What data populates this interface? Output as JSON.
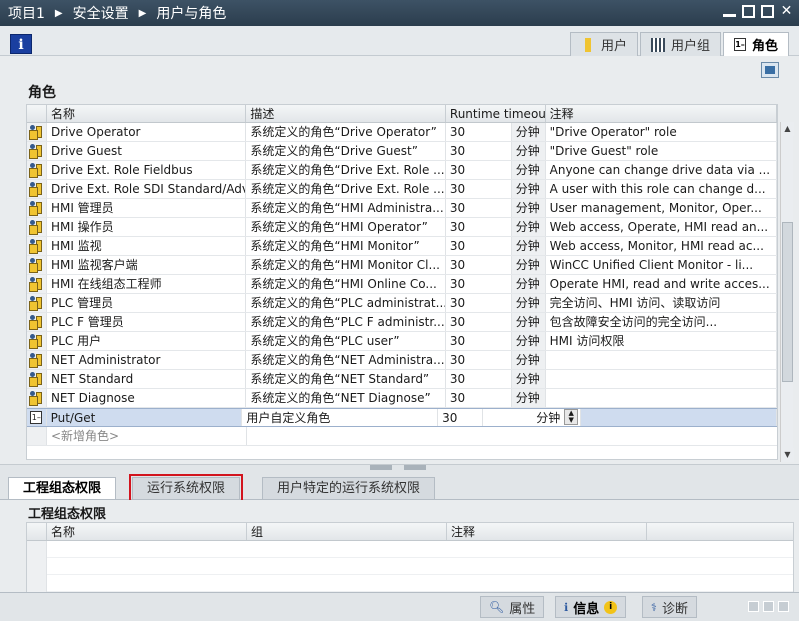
{
  "breadcrumb": [
    "项目1",
    "安全设置",
    "用户与角色"
  ],
  "view_tabs": [
    {
      "label": "用户",
      "active": false
    },
    {
      "label": "用户组",
      "active": false
    },
    {
      "label": "角色",
      "active": true
    }
  ],
  "roles_section": {
    "title": "角色",
    "columns": {
      "name": "名称",
      "desc": "描述",
      "runtime": "Runtime timeout",
      "note": "注释"
    },
    "rows": [
      {
        "name": "Drive Operator",
        "desc": "系统定义的角色“Drive Operator”",
        "rt": "30",
        "unit": "分钟",
        "note": "\"Drive Operator\" role"
      },
      {
        "name": "Drive Guest",
        "desc": "系统定义的角色“Drive Guest”",
        "rt": "30",
        "unit": "分钟",
        "note": "\"Drive Guest\" role"
      },
      {
        "name": "Drive Ext. Role Fieldbus",
        "desc": "系统定义的角色“Drive Ext. Role ...",
        "rt": "30",
        "unit": "分钟",
        "note": "Anyone can change drive data via ..."
      },
      {
        "name": "Drive Ext. Role SDI Standard/Adv",
        "desc": "系统定义的角色“Drive Ext. Role ...",
        "rt": "30",
        "unit": "分钟",
        "note": "A user with this role can change d..."
      },
      {
        "name": "HMI 管理员",
        "desc": "系统定义的角色“HMI Administra...",
        "rt": "30",
        "unit": "分钟",
        "note": "User management, Monitor, Oper..."
      },
      {
        "name": "HMI 操作员",
        "desc": "系统定义的角色“HMI Operator”",
        "rt": "30",
        "unit": "分钟",
        "note": "Web access, Operate, HMI read an..."
      },
      {
        "name": "HMI 监视",
        "desc": "系统定义的角色“HMI Monitor”",
        "rt": "30",
        "unit": "分钟",
        "note": "Web access, Monitor, HMI read ac..."
      },
      {
        "name": "HMI 监视客户端",
        "desc": "系统定义的角色“HMI Monitor Cl...",
        "rt": "30",
        "unit": "分钟",
        "note": "WinCC Unified Client Monitor - li..."
      },
      {
        "name": "HMI 在线组态工程师",
        "desc": "系统定义的角色“HMI Online Co...",
        "rt": "30",
        "unit": "分钟",
        "note": "Operate HMI, read and write acces..."
      },
      {
        "name": "PLC 管理员",
        "desc": "系统定义的角色“PLC administrat...",
        "rt": "30",
        "unit": "分钟",
        "note": "完全访问、HMI 访问、读取访问"
      },
      {
        "name": "PLC F 管理员",
        "desc": "系统定义的角色“PLC F administr...",
        "rt": "30",
        "unit": "分钟",
        "note": "包含故障安全访问的完全访问..."
      },
      {
        "name": "PLC 用户",
        "desc": "系统定义的角色“PLC user”",
        "rt": "30",
        "unit": "分钟",
        "note": "HMI 访问权限"
      },
      {
        "name": "NET Administrator",
        "desc": "系统定义的角色“NET Administra...",
        "rt": "30",
        "unit": "分钟",
        "note": ""
      },
      {
        "name": "NET Standard",
        "desc": "系统定义的角色“NET Standard”",
        "rt": "30",
        "unit": "分钟",
        "note": ""
      },
      {
        "name": "NET Diagnose",
        "desc": "系统定义的角色“NET Diagnose”",
        "rt": "30",
        "unit": "分钟",
        "note": ""
      }
    ],
    "selected_row": {
      "name": "Put/Get",
      "desc": "用户自定义角色",
      "rt": "30",
      "unit": "分钟",
      "note": ""
    },
    "add_placeholder": "<新增角色>"
  },
  "lower_tabs": [
    {
      "label": "工程组态权限",
      "active": true
    },
    {
      "label": "运行系统权限",
      "active": false,
      "highlighted": true
    },
    {
      "label": "用户特定的运行系统权限",
      "active": false
    }
  ],
  "lower_section": {
    "title": "工程组态权限",
    "columns": {
      "name": "名称",
      "group": "组",
      "note": "注释"
    }
  },
  "statusbar": {
    "properties": "属性",
    "info": "信息",
    "diagnostics": "诊断"
  },
  "colors": {
    "highlight_outline": "#d2141e",
    "selected_row": "#cfdcef",
    "titlebar": "#2b3d4d"
  }
}
